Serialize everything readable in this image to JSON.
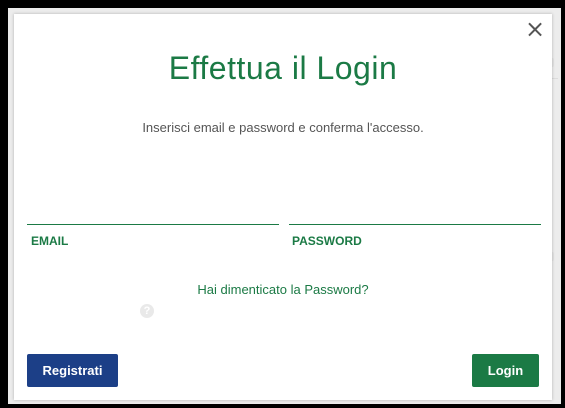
{
  "modal": {
    "close_symbol": "×",
    "title": "Effettua il Login",
    "subtitle": "Inserisci email e password e conferma l'accesso.",
    "email_label": "EMAIL",
    "email_value": "",
    "password_label": "PASSWORD",
    "password_value": "",
    "forgot_link": "Hai dimenticato la Password?",
    "help_symbol": "?",
    "register_button": "Registrati",
    "login_button": "Login"
  },
  "icons": {
    "close": "close-icon",
    "help": "question-circle-icon"
  },
  "colors": {
    "accent_green": "#1b7a45",
    "register_blue": "#1c3f87",
    "overlay_border": "#000000"
  }
}
